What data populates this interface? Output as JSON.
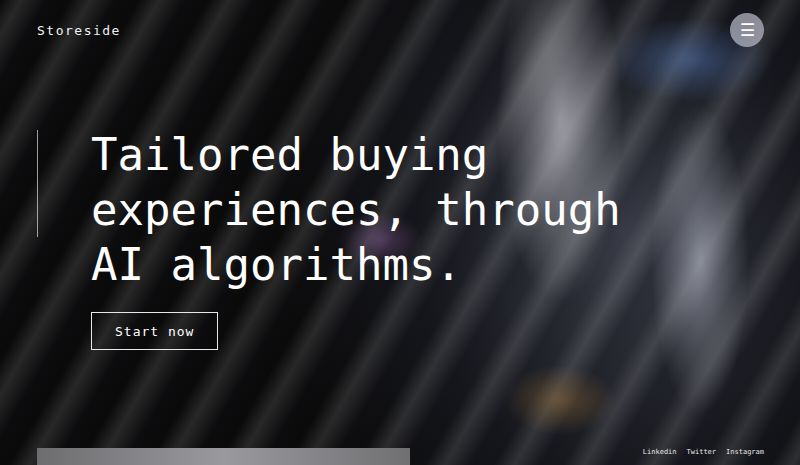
{
  "header": {
    "logo": "Storeside",
    "menu_button": "☰"
  },
  "hero": {
    "headline": [
      "Tailored buying",
      "experiences, through",
      "AI algorithms."
    ],
    "button": "Start now"
  },
  "footer": {
    "links": [
      "Linkedin",
      "Twitter",
      "Instagram"
    ]
  }
}
